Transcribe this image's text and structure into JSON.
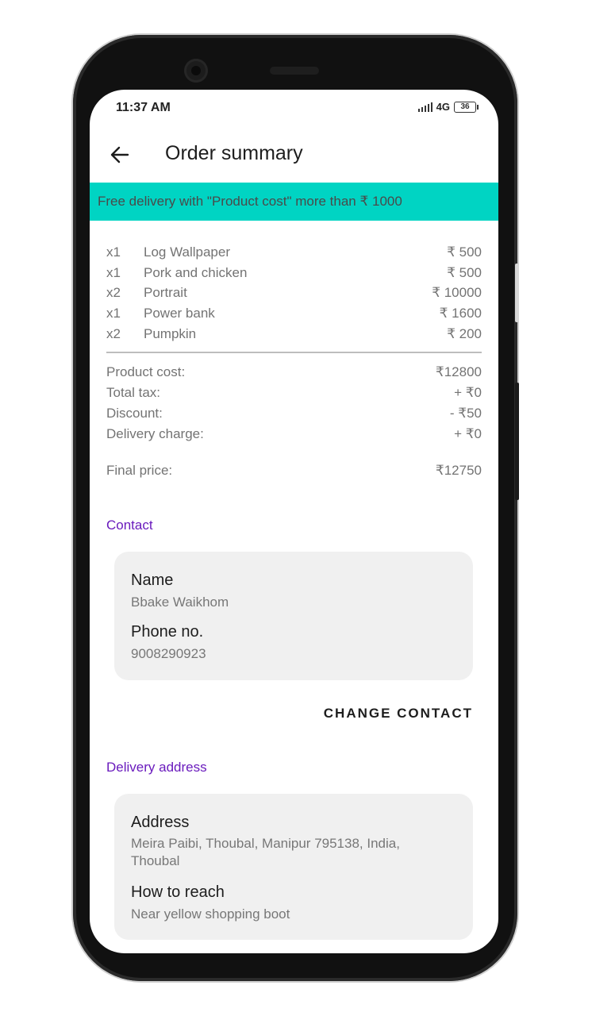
{
  "status_bar": {
    "time": "11:37 AM",
    "network": "4G",
    "battery": "36"
  },
  "app_bar": {
    "title": "Order summary"
  },
  "banner": {
    "text": "Free delivery with \"Product cost\" more than ₹ 1000"
  },
  "items": [
    {
      "qty": "x1",
      "name": "Log Wallpaper",
      "price": "₹ 500"
    },
    {
      "qty": "x1",
      "name": "Pork and chicken",
      "price": "₹ 500"
    },
    {
      "qty": "x2",
      "name": "Portrait",
      "price": "₹ 10000"
    },
    {
      "qty": "x1",
      "name": "Power bank",
      "price": "₹ 1600"
    },
    {
      "qty": "x2",
      "name": "Pumpkin",
      "price": "₹ 200"
    }
  ],
  "summary": {
    "product_cost_label": "Product cost:",
    "product_cost": "₹12800",
    "total_tax_label": "Total tax:",
    "total_tax": "+ ₹0",
    "discount_label": "Discount:",
    "discount": "- ₹50",
    "delivery_label": "Delivery charge:",
    "delivery": "+ ₹0",
    "final_label": "Final price:",
    "final": "₹12750"
  },
  "contact": {
    "section_title": "Contact",
    "name_label": "Name",
    "name": "Bbake Waikhom",
    "phone_label": "Phone no.",
    "phone": "9008290923",
    "change_button": "CHANGE CONTACT"
  },
  "delivery_address": {
    "section_title": "Delivery address",
    "address_label": "Address",
    "address": "Meira Paibi, Thoubal, Manipur 795138, India, Thoubal",
    "reach_label": "How to reach",
    "reach": "Near yellow shopping boot"
  },
  "colors": {
    "banner": "#00d4c3",
    "accent": "#6a1bbd",
    "card": "#f0f0f0"
  }
}
